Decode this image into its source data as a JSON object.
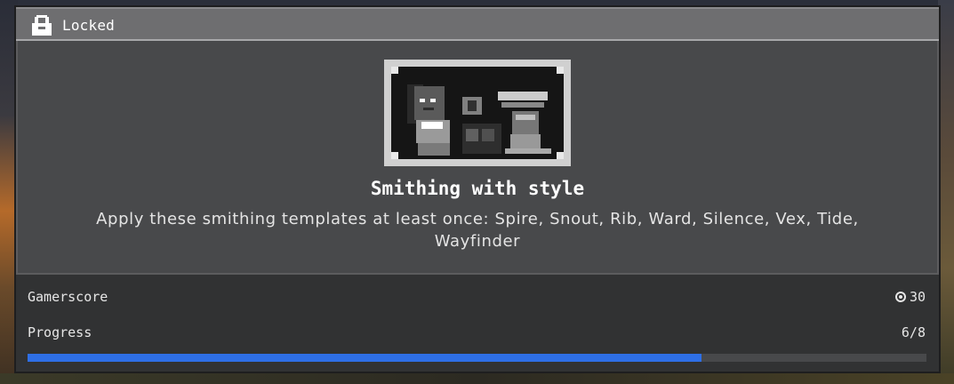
{
  "header": {
    "status_label": "Locked",
    "icon": "lock-icon"
  },
  "achievement": {
    "image_icon": "armor-trim-artwork",
    "title": "Smithing with style",
    "description": "Apply these smithing templates at least once: Spire, Snout, Rib, Ward, Silence, Vex, Tide, Wayfinder"
  },
  "footer": {
    "gamerscore_label": "Gamerscore",
    "gamerscore_icon": "gamerscore-icon",
    "gamerscore_value": "30",
    "progress_label": "Progress",
    "progress_value": "6/8",
    "progress_fraction": 0.75
  },
  "colors": {
    "panel": "#313233",
    "header": "#6e6e70",
    "progress_fill": "#2e6fe6",
    "progress_track": "#48494b"
  }
}
